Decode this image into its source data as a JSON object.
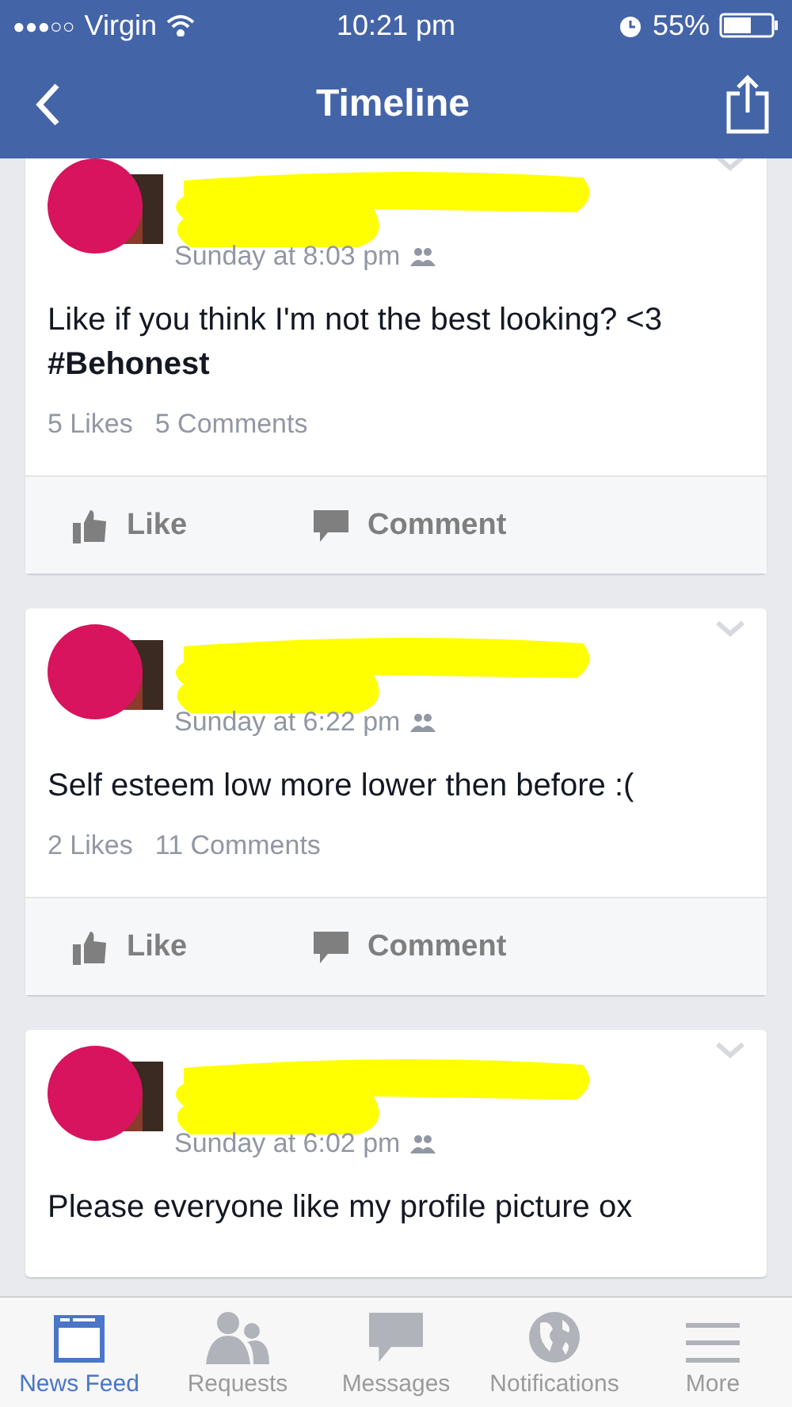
{
  "status_bar": {
    "carrier": "Virgin",
    "signal_dots": "●●●○○",
    "time": "10:21 pm",
    "battery": "55%"
  },
  "nav": {
    "title": "Timeline"
  },
  "posts": [
    {
      "time": "Sunday at 8:03 pm",
      "text": "Like if you think I'm not the best looking? <3\n**#Behonest**",
      "likes": "5 Likes",
      "comments": "5 Comments",
      "actions": [
        "Like",
        "Comment"
      ]
    },
    {
      "time": "Sunday at 6:22 pm",
      "text": "Self esteem low more lower then before :(",
      "likes": "2 Likes",
      "comments": "11 Comments",
      "actions": [
        "Like",
        "Comment"
      ]
    },
    {
      "time": "Sunday at 6:02 pm",
      "text": "Please everyone like my profile picture ox"
    }
  ],
  "tabs": [
    {
      "kind": "feed",
      "label": "News Feed",
      "selected": true
    },
    {
      "kind": "requests",
      "label": "Requests",
      "selected": false
    },
    {
      "kind": "messages",
      "label": "Messages",
      "selected": false
    },
    {
      "kind": "notifications",
      "label": "Notifications",
      "selected": false
    },
    {
      "kind": "more",
      "label": "More",
      "selected": false
    }
  ]
}
